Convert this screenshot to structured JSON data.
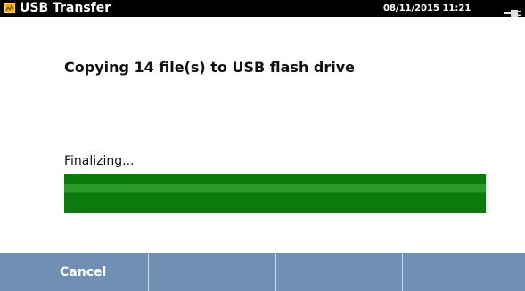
{
  "titlebar": {
    "title": "USB Transfer",
    "datetime": "08/11/2015 11:21",
    "app_icon": "analyzer-app-icon",
    "status_icon": "usb-plug-icon"
  },
  "transfer": {
    "heading": "Copying 14 file(s) to USB flash drive",
    "status": "Finalizing...",
    "progress_fraction": 1.0
  },
  "softkeys": [
    {
      "label": "Cancel"
    },
    {
      "label": ""
    },
    {
      "label": ""
    },
    {
      "label": ""
    }
  ],
  "colors": {
    "progress_green": "#0c7a0c",
    "softkey_bar": "#6f8fb3",
    "title_bar": "#000000"
  }
}
